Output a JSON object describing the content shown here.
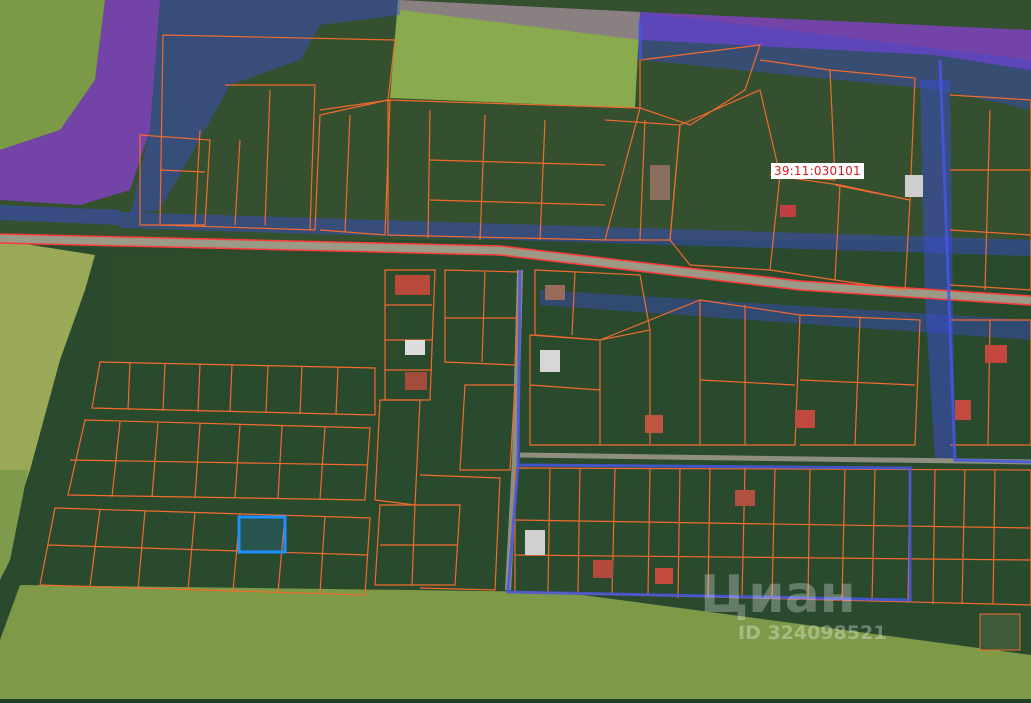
{
  "map": {
    "cadastral_label": "39:11:030101",
    "selected_parcel_color": "#1e90ff",
    "parcel_line_color": "#f26a2e",
    "road_line_color": "#ff3b3b",
    "zone_overlay_color": "#3b4bd6",
    "restricted_zone_color": "#8a3fd0"
  },
  "watermark": {
    "brand": "Циан",
    "listing_id": "ID 324098521"
  }
}
